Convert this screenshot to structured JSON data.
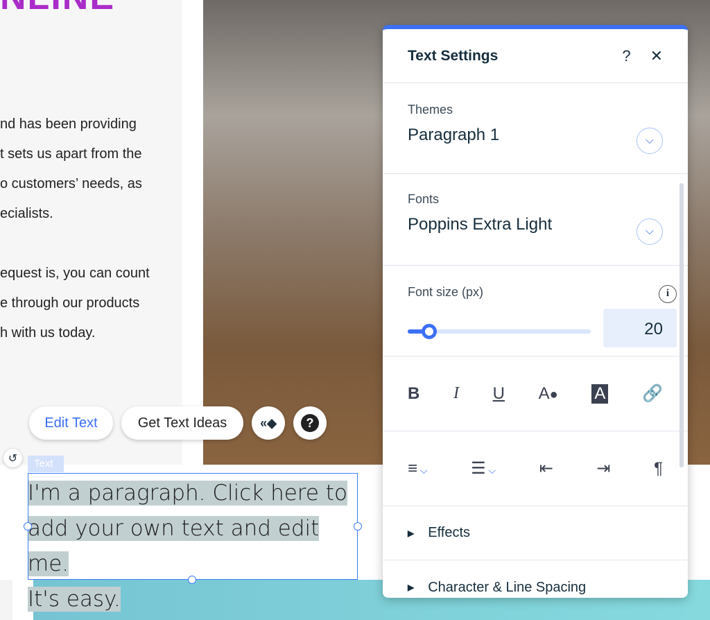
{
  "page": {
    "heading": "NLINE",
    "body_lines": [
      "nd has been providing",
      "t sets us apart from the",
      "o customers’ needs, as",
      "ecialists.",
      "",
      "equest is, you can count",
      "e through our products",
      "h with us today."
    ]
  },
  "toolbar": {
    "edit_text": "Edit Text",
    "get_text_ideas": "Get Text Ideas"
  },
  "element": {
    "tag": "Text",
    "paragraph_lines": [
      "I'm a paragraph. Click here to",
      "add your own text and edit me.",
      "It's easy."
    ]
  },
  "panel": {
    "title": "Text Settings",
    "help": "?",
    "close": "✕",
    "themes": {
      "label": "Themes",
      "value": "Paragraph 1"
    },
    "fonts": {
      "label": "Fonts",
      "value": "Poppins Extra Light"
    },
    "font_size": {
      "label": "Font size (px)",
      "value": "20",
      "slider_percent": 10
    },
    "effects": "Effects",
    "spacing": "Character & Line Spacing"
  },
  "colors": {
    "accent": "#3b6ff5",
    "heading": "#a92cc8"
  }
}
